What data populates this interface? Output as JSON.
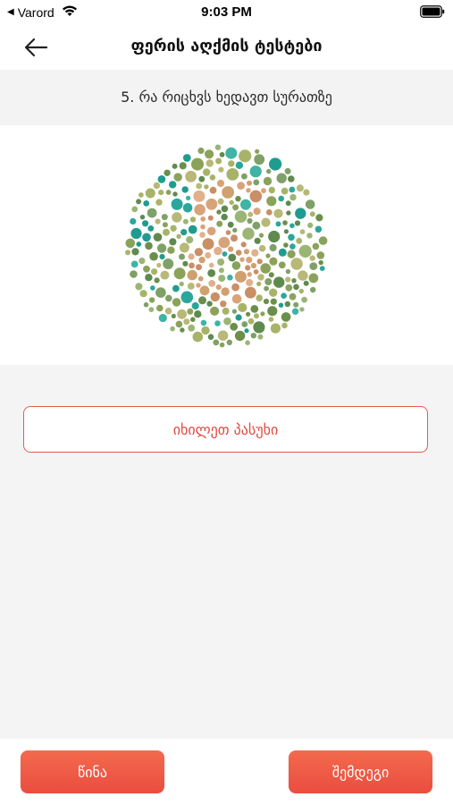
{
  "status_bar": {
    "carrier": "Varord",
    "time": "9:03 PM",
    "back_indicator": "◀",
    "icons": [
      "wifi-icon",
      "battery-icon"
    ]
  },
  "nav": {
    "title": "ფერის აღქმის ტესტები",
    "back_icon": "arrow-left-icon"
  },
  "question": {
    "text": "5. რა რიცხვს ხედავთ სურათზე"
  },
  "plate": {
    "colors": {
      "background_dots": [
        "#6b8f4a",
        "#8aa25a",
        "#a8b36a",
        "#5f8a4f",
        "#9bb575",
        "#b8b878",
        "#7fa068"
      ],
      "teal_dots": [
        "#2aa79b",
        "#3fb3a4",
        "#1f9c8f"
      ],
      "figure_dots": [
        "#d9a37a",
        "#c98f66",
        "#e0b08c",
        "#cfa070"
      ]
    }
  },
  "actions": {
    "show_answer": "იხილეთ პასუხი",
    "previous": "წინა",
    "next": "შემდეგი"
  },
  "colors": {
    "accent": "#ea4d3f",
    "band_background": "#f3f3f3"
  }
}
